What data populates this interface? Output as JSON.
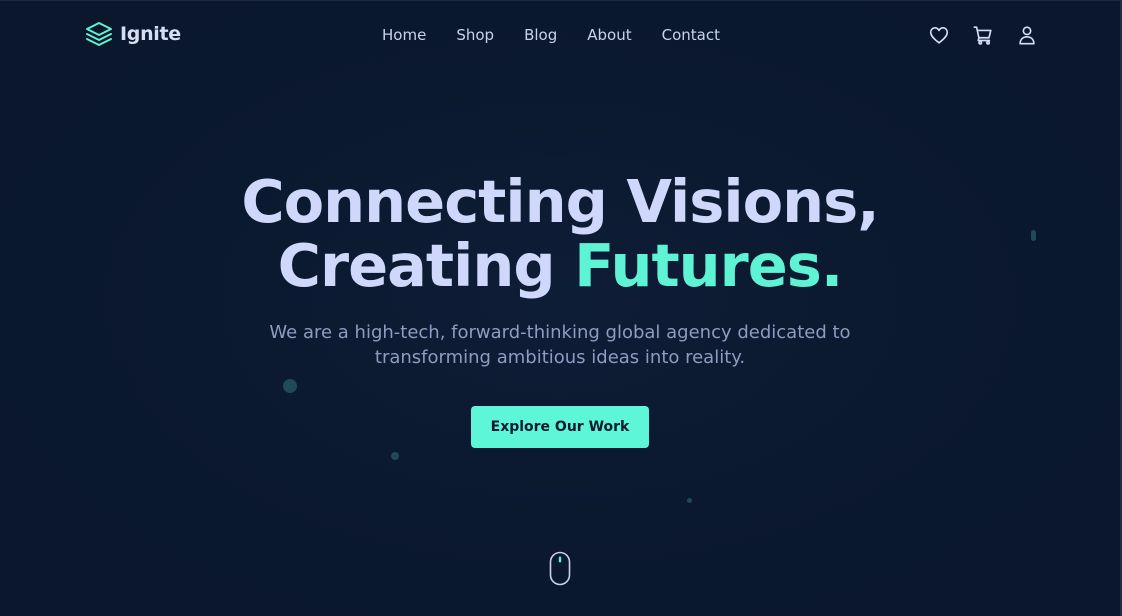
{
  "brand": {
    "name": "Ignite",
    "logo_icon": "layers-icon",
    "accent_color": "#5ef3d4"
  },
  "nav": {
    "items": [
      {
        "label": "Home"
      },
      {
        "label": "Shop"
      },
      {
        "label": "Blog"
      },
      {
        "label": "About"
      },
      {
        "label": "Contact"
      }
    ]
  },
  "header_actions": [
    {
      "icon": "heart-icon"
    },
    {
      "icon": "cart-icon"
    },
    {
      "icon": "user-icon"
    }
  ],
  "hero": {
    "line1": "Connecting Visions,",
    "line2_plain": "Creating ",
    "line2_accent": "Futures.",
    "subtitle_line1": "We are a high-tech, forward-thinking global agency dedicated to",
    "subtitle_line2": "transforming ambitious ideas into reality.",
    "cta_label": "Explore Our Work",
    "cta_color": "#5ef6d9",
    "scroll_indicator_icon": "mouse-scroll-icon"
  },
  "colors": {
    "background": "#0c1a31",
    "heading": "#cfd8fb",
    "body_text": "#8f9bc0"
  }
}
